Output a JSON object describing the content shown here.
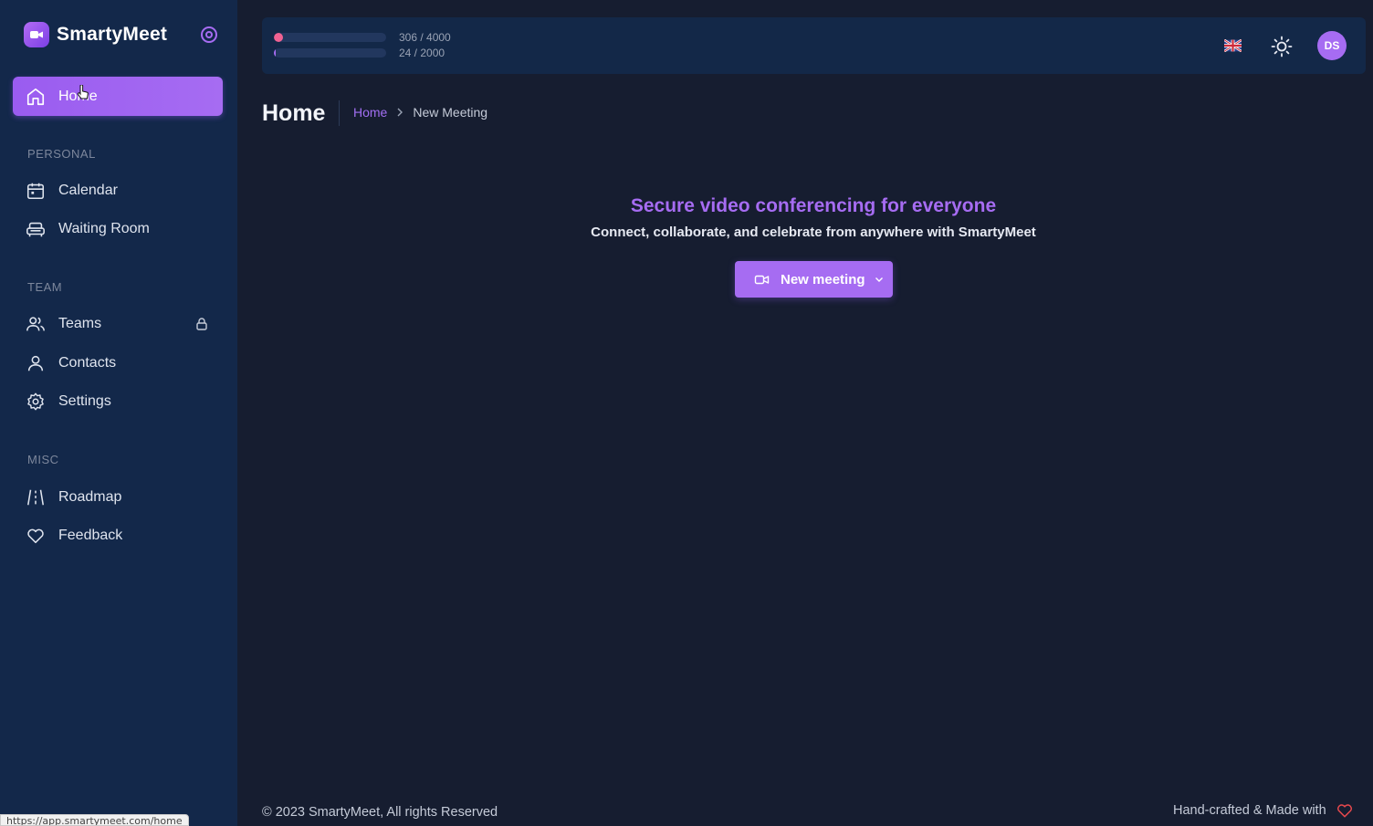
{
  "brand": {
    "name": "SmartyMeet"
  },
  "sidebar": {
    "home_label": "Home",
    "sections": {
      "personal": "PERSONAL",
      "team": "TEAM",
      "misc": "MISC"
    },
    "items": {
      "calendar": "Calendar",
      "waiting_room": "Waiting Room",
      "teams": "Teams",
      "contacts": "Contacts",
      "settings": "Settings",
      "roadmap": "Roadmap",
      "feedback": "Feedback"
    }
  },
  "topbar": {
    "usage": [
      {
        "text": "306 / 4000",
        "fraction": 0.0765,
        "color": "#f06292"
      },
      {
        "text": "24 / 2000",
        "fraction": 0.012,
        "color": "#a66cf2"
      }
    ],
    "language_flag": "uk-flag-icon",
    "avatar_initials": "DS"
  },
  "page": {
    "title": "Home",
    "breadcrumb": {
      "link": "Home",
      "current": "New Meeting"
    }
  },
  "hero": {
    "title": "Secure video conferencing for everyone",
    "subtitle": "Connect, collaborate, and celebrate from anywhere with SmartyMeet",
    "button_label": "New meeting"
  },
  "footer": {
    "copyright": "© 2023 SmartyMeet, All rights Reserved",
    "credit": "Hand-crafted & Made with"
  },
  "status_bar": {
    "url": "https://app.smartymeet.com/home"
  },
  "colors": {
    "accent": "#a66cf2",
    "sidebar_bg": "#13284a",
    "page_bg": "#161d30",
    "heart": "#e5484d"
  }
}
